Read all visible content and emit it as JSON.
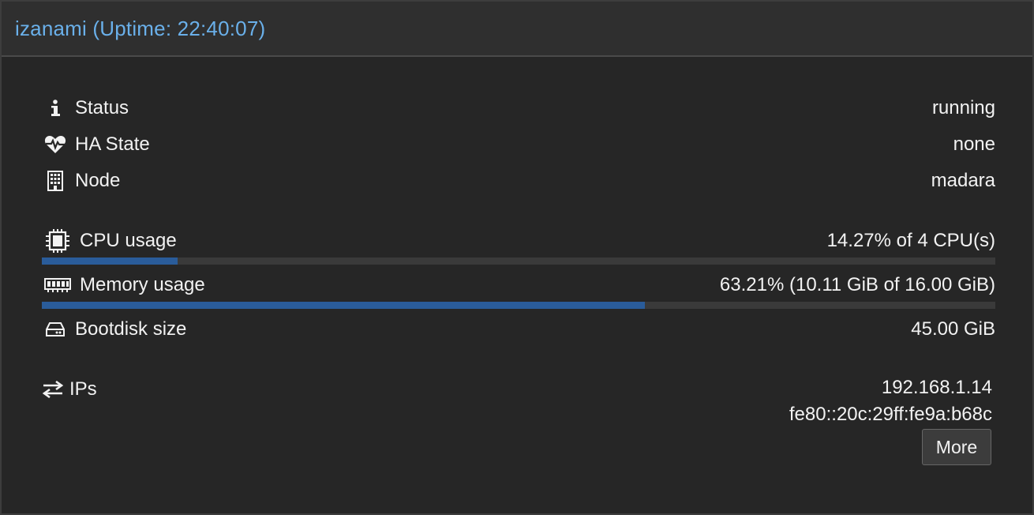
{
  "header": {
    "title": "izanami (Uptime: 22:40:07)"
  },
  "rows": {
    "status": {
      "icon": "info-icon",
      "label": "Status",
      "value": "running"
    },
    "ha_state": {
      "icon": "heartbeat-icon",
      "label": "HA State",
      "value": "none"
    },
    "node": {
      "icon": "building-icon",
      "label": "Node",
      "value": "madara"
    },
    "cpu": {
      "icon": "cpu-chip-icon",
      "label": "CPU usage",
      "value": "14.27% of 4 CPU(s)",
      "fraction": 0.1427
    },
    "memory": {
      "icon": "memory-icon",
      "label": "Memory usage",
      "value": "63.21% (10.11 GiB of 16.00 GiB)",
      "fraction": 0.6321
    },
    "bootdisk": {
      "icon": "hdd-icon",
      "label": "Bootdisk size",
      "value": "45.00 GiB"
    },
    "ips": {
      "icon": "exchange-icon",
      "label": "IPs",
      "values": [
        "192.168.1.14",
        "fe80::20c:29ff:fe9a:b68c"
      ]
    }
  },
  "more_button": {
    "label": "More"
  },
  "colors": {
    "accent": "#6ab0ea",
    "bar_fill": "#2a5c9a",
    "bar_track": "#3a3a3a"
  }
}
